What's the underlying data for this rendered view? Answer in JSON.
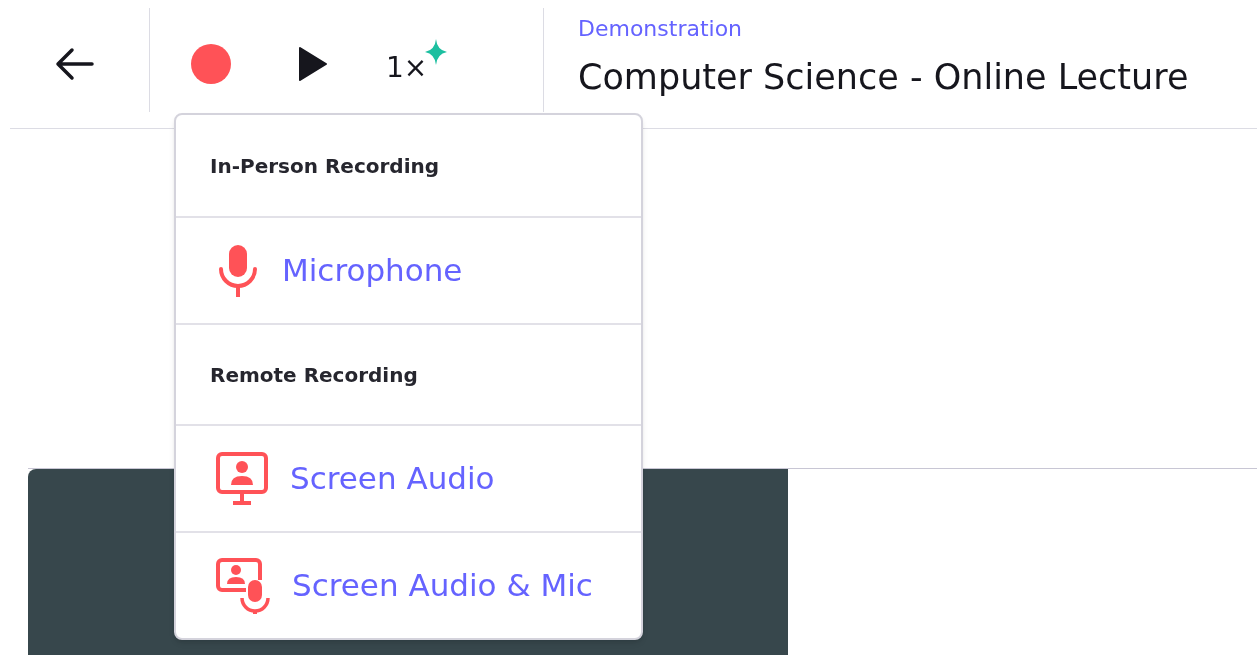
{
  "toolbar": {
    "speed": "1×"
  },
  "header": {
    "breadcrumb": "Demonstration",
    "title": "Computer Science - Online Lecture"
  },
  "menu": {
    "items": [
      {
        "kind": "heading",
        "label": "In-Person Recording"
      },
      {
        "kind": "microphone",
        "label": "Microphone"
      },
      {
        "kind": "heading",
        "label": "Remote Recording"
      },
      {
        "kind": "screen",
        "label": "Screen Audio"
      },
      {
        "kind": "screenmic",
        "label": "Screen Audio & Mic"
      }
    ]
  }
}
